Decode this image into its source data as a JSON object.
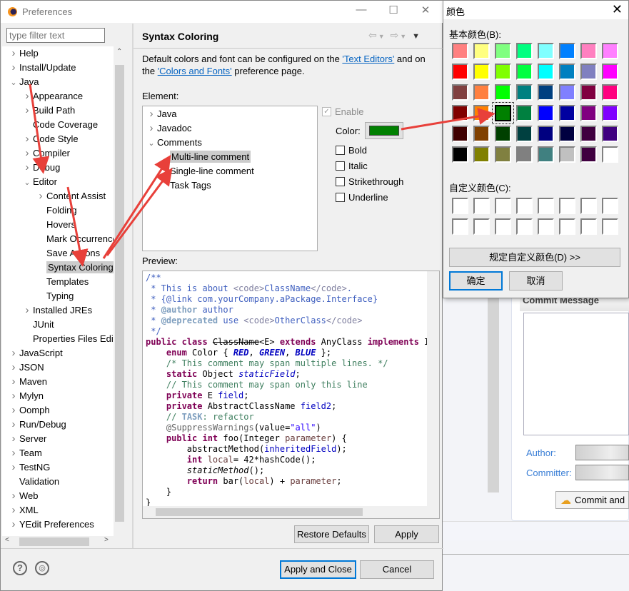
{
  "window": {
    "title": "Preferences",
    "minimize": "—",
    "maximize": "☐",
    "close": "✕"
  },
  "filter": {
    "placeholder": "type filter text"
  },
  "tree": [
    {
      "label": "Help",
      "level": 0,
      "state": "collapsed"
    },
    {
      "label": "Install/Update",
      "level": 0,
      "state": "collapsed"
    },
    {
      "label": "Java",
      "level": 0,
      "state": "expanded"
    },
    {
      "label": "Appearance",
      "level": 1,
      "state": "collapsed"
    },
    {
      "label": "Build Path",
      "level": 1,
      "state": "collapsed"
    },
    {
      "label": "Code Coverage",
      "level": 1,
      "state": "leaf"
    },
    {
      "label": "Code Style",
      "level": 1,
      "state": "collapsed"
    },
    {
      "label": "Compiler",
      "level": 1,
      "state": "collapsed"
    },
    {
      "label": "Debug",
      "level": 1,
      "state": "collapsed"
    },
    {
      "label": "Editor",
      "level": 1,
      "state": "expanded"
    },
    {
      "label": "Content Assist",
      "level": 2,
      "state": "collapsed"
    },
    {
      "label": "Folding",
      "level": 2,
      "state": "leaf"
    },
    {
      "label": "Hovers",
      "level": 2,
      "state": "leaf"
    },
    {
      "label": "Mark Occurrences",
      "level": 2,
      "state": "leaf"
    },
    {
      "label": "Save Actions",
      "level": 2,
      "state": "leaf"
    },
    {
      "label": "Syntax Coloring",
      "level": 2,
      "state": "leaf",
      "selected": true
    },
    {
      "label": "Templates",
      "level": 2,
      "state": "leaf"
    },
    {
      "label": "Typing",
      "level": 2,
      "state": "leaf"
    },
    {
      "label": "Installed JREs",
      "level": 1,
      "state": "collapsed"
    },
    {
      "label": "JUnit",
      "level": 1,
      "state": "leaf"
    },
    {
      "label": "Properties Files Editor",
      "level": 1,
      "state": "leaf"
    },
    {
      "label": "JavaScript",
      "level": 0,
      "state": "collapsed"
    },
    {
      "label": "JSON",
      "level": 0,
      "state": "collapsed"
    },
    {
      "label": "Maven",
      "level": 0,
      "state": "collapsed"
    },
    {
      "label": "Mylyn",
      "level": 0,
      "state": "collapsed"
    },
    {
      "label": "Oomph",
      "level": 0,
      "state": "collapsed"
    },
    {
      "label": "Run/Debug",
      "level": 0,
      "state": "collapsed"
    },
    {
      "label": "Server",
      "level": 0,
      "state": "collapsed"
    },
    {
      "label": "Team",
      "level": 0,
      "state": "collapsed"
    },
    {
      "label": "TestNG",
      "level": 0,
      "state": "collapsed"
    },
    {
      "label": "Validation",
      "level": 0,
      "state": "leaf"
    },
    {
      "label": "Web",
      "level": 0,
      "state": "collapsed"
    },
    {
      "label": "XML",
      "level": 0,
      "state": "collapsed"
    },
    {
      "label": "YEdit Preferences",
      "level": 0,
      "state": "collapsed"
    }
  ],
  "page": {
    "title": "Syntax Coloring",
    "desc_1": "Default colors and font can be configured on the ",
    "link_text_editors": "'Text Editors'",
    "desc_2": " and on the ",
    "link_colors_fonts": "'Colors and Fonts'",
    "desc_3": " preference page.",
    "element_label": "Element:",
    "preview_label": "Preview:",
    "elements": [
      {
        "label": "Java",
        "level": 0,
        "state": "collapsed"
      },
      {
        "label": "Javadoc",
        "level": 0,
        "state": "collapsed"
      },
      {
        "label": "Comments",
        "level": 0,
        "state": "expanded"
      },
      {
        "label": "Multi-line comment",
        "level": 1,
        "state": "leaf",
        "selected": true
      },
      {
        "label": "Single-line comment",
        "level": 1,
        "state": "leaf"
      },
      {
        "label": "Task Tags",
        "level": 1,
        "state": "leaf"
      }
    ],
    "enable": {
      "label": "Enable",
      "checked": true,
      "disabled": true
    },
    "color_label": "Color:",
    "color_value": "#008000",
    "styles": [
      {
        "label": "Bold",
        "checked": false
      },
      {
        "label": "Italic",
        "checked": false
      },
      {
        "label": "Strikethrough",
        "checked": false
      },
      {
        "label": "Underline",
        "checked": false
      }
    ],
    "restore_defaults": "Restore Defaults",
    "apply": "Apply"
  },
  "code": [
    [
      [
        "/**",
        "jd"
      ]
    ],
    [
      [
        " * This is about ",
        "jd"
      ],
      [
        "<code>",
        "jt"
      ],
      [
        "ClassName",
        "jd"
      ],
      [
        "</code>",
        "jt"
      ],
      [
        ".",
        "jd"
      ]
    ],
    [
      [
        " * {@link com.yourCompany.aPackage.Interface}",
        "jd"
      ]
    ],
    [
      [
        " * ",
        "jd"
      ],
      [
        "@author",
        "jtag"
      ],
      [
        " author",
        "jd"
      ]
    ],
    [
      [
        " * ",
        "jd"
      ],
      [
        "@deprecated",
        "jtag"
      ],
      [
        " use ",
        "jd"
      ],
      [
        "<code>",
        "jt"
      ],
      [
        "OtherClass",
        "jd"
      ],
      [
        "</code>",
        "jt"
      ]
    ],
    [
      [
        " */",
        "jd"
      ]
    ],
    [
      [
        "public class ",
        "kw"
      ],
      [
        "ClassName",
        "strike"
      ],
      [
        "<E> ",
        "pl"
      ],
      [
        "extends ",
        "kw"
      ],
      [
        "AnyClass ",
        "pl"
      ],
      [
        "implements ",
        "kw"
      ],
      [
        "Interface",
        "pl"
      ]
    ],
    [
      [
        "    "
      ],
      [
        "enum ",
        "kw"
      ],
      [
        "Color { ",
        "pl"
      ],
      [
        "RED",
        "en"
      ],
      [
        ", ",
        "pl"
      ],
      [
        "GREEN",
        "en"
      ],
      [
        ", ",
        "pl"
      ],
      [
        "BLUE",
        "en"
      ],
      [
        " };",
        "pl"
      ]
    ],
    [
      [
        "    "
      ],
      [
        "/* This comment may span multiple lines. */",
        "cm"
      ]
    ],
    [
      [
        "    "
      ],
      [
        "static ",
        "kw"
      ],
      [
        "Object ",
        "pl"
      ],
      [
        "staticField",
        "sf"
      ],
      [
        ";",
        "pl"
      ]
    ],
    [
      [
        "    "
      ],
      [
        "// This comment may span only this line",
        "cm"
      ]
    ],
    [
      [
        "    "
      ],
      [
        "private ",
        "kw"
      ],
      [
        "E ",
        "pl"
      ],
      [
        "field",
        "fd"
      ],
      [
        ";",
        "pl"
      ]
    ],
    [
      [
        "    "
      ],
      [
        "private ",
        "kw"
      ],
      [
        "AbstractClassName ",
        "pl"
      ],
      [
        "field2",
        "fd"
      ],
      [
        ";",
        "pl"
      ]
    ],
    [
      [
        "    "
      ],
      [
        "// ",
        "cm"
      ],
      [
        "TASK",
        "task"
      ],
      [
        ": refactor",
        "cm"
      ]
    ],
    [
      [
        "    "
      ],
      [
        "@SuppressWarnings",
        "an"
      ],
      [
        "(value=",
        "pl"
      ],
      [
        "\"all\"",
        "st"
      ],
      [
        ")",
        "pl"
      ]
    ],
    [
      [
        "    "
      ],
      [
        "public int ",
        "kw"
      ],
      [
        "foo(Integer ",
        "pl"
      ],
      [
        "parameter",
        "pa"
      ],
      [
        ") {",
        "pl"
      ]
    ],
    [
      [
        "        "
      ],
      [
        "abstractMethod(",
        "pl"
      ],
      [
        "inheritedField",
        "fd"
      ],
      [
        ");",
        "pl"
      ]
    ],
    [
      [
        "        "
      ],
      [
        "int ",
        "kw"
      ],
      [
        "local",
        "lv"
      ],
      [
        "= 42*hashCode();",
        "pl"
      ]
    ],
    [
      [
        "        "
      ],
      [
        "staticMethod",
        "sm"
      ],
      [
        "();",
        "pl"
      ]
    ],
    [
      [
        "        "
      ],
      [
        "return ",
        "kw"
      ],
      [
        "bar(",
        "pl"
      ],
      [
        "local",
        "lv"
      ],
      [
        ") + ",
        "pl"
      ],
      [
        "parameter",
        "pa"
      ],
      [
        ";",
        "pl"
      ]
    ],
    [
      [
        "    }",
        "pl"
      ]
    ],
    [
      [
        "}",
        "pl"
      ]
    ]
  ],
  "footer": {
    "apply_close": "Apply and Close",
    "cancel": "Cancel",
    "help_icon": "?",
    "import_icon": "◎"
  },
  "color_dialog": {
    "title": "颜色",
    "close": "✕",
    "basic_label": "基本颜色(B):",
    "basic_colors": [
      "#FF8080",
      "#FFFF80",
      "#80FF80",
      "#00FF80",
      "#80FFFF",
      "#0080FF",
      "#FF80C0",
      "#FF80FF",
      "#FF0000",
      "#FFFF00",
      "#80FF00",
      "#00FF40",
      "#00FFFF",
      "#0080C0",
      "#8080C0",
      "#FF00FF",
      "#804040",
      "#FF8040",
      "#00FF00",
      "#008080",
      "#004080",
      "#8080FF",
      "#800040",
      "#FF0080",
      "#800000",
      "#FF8000",
      "#008000",
      "#008040",
      "#0000FF",
      "#0000A0",
      "#800080",
      "#8000FF",
      "#400000",
      "#804000",
      "#004000",
      "#004040",
      "#000080",
      "#000040",
      "#400040",
      "#400080",
      "#000000",
      "#808000",
      "#808040",
      "#808080",
      "#408080",
      "#C0C0C0",
      "#400040",
      "#FFFFFF"
    ],
    "selected_color": "#008000",
    "custom_label": "自定义颜色(C):",
    "define_custom": "规定自定义颜色(D) >>",
    "ok": "确定",
    "cancel": "取消"
  },
  "background": {
    "commit_message": "Commit Message",
    "author": "Author:",
    "committer": "Committer:",
    "commit_button": "Commit and"
  },
  "annotation_color": "#e8403a"
}
